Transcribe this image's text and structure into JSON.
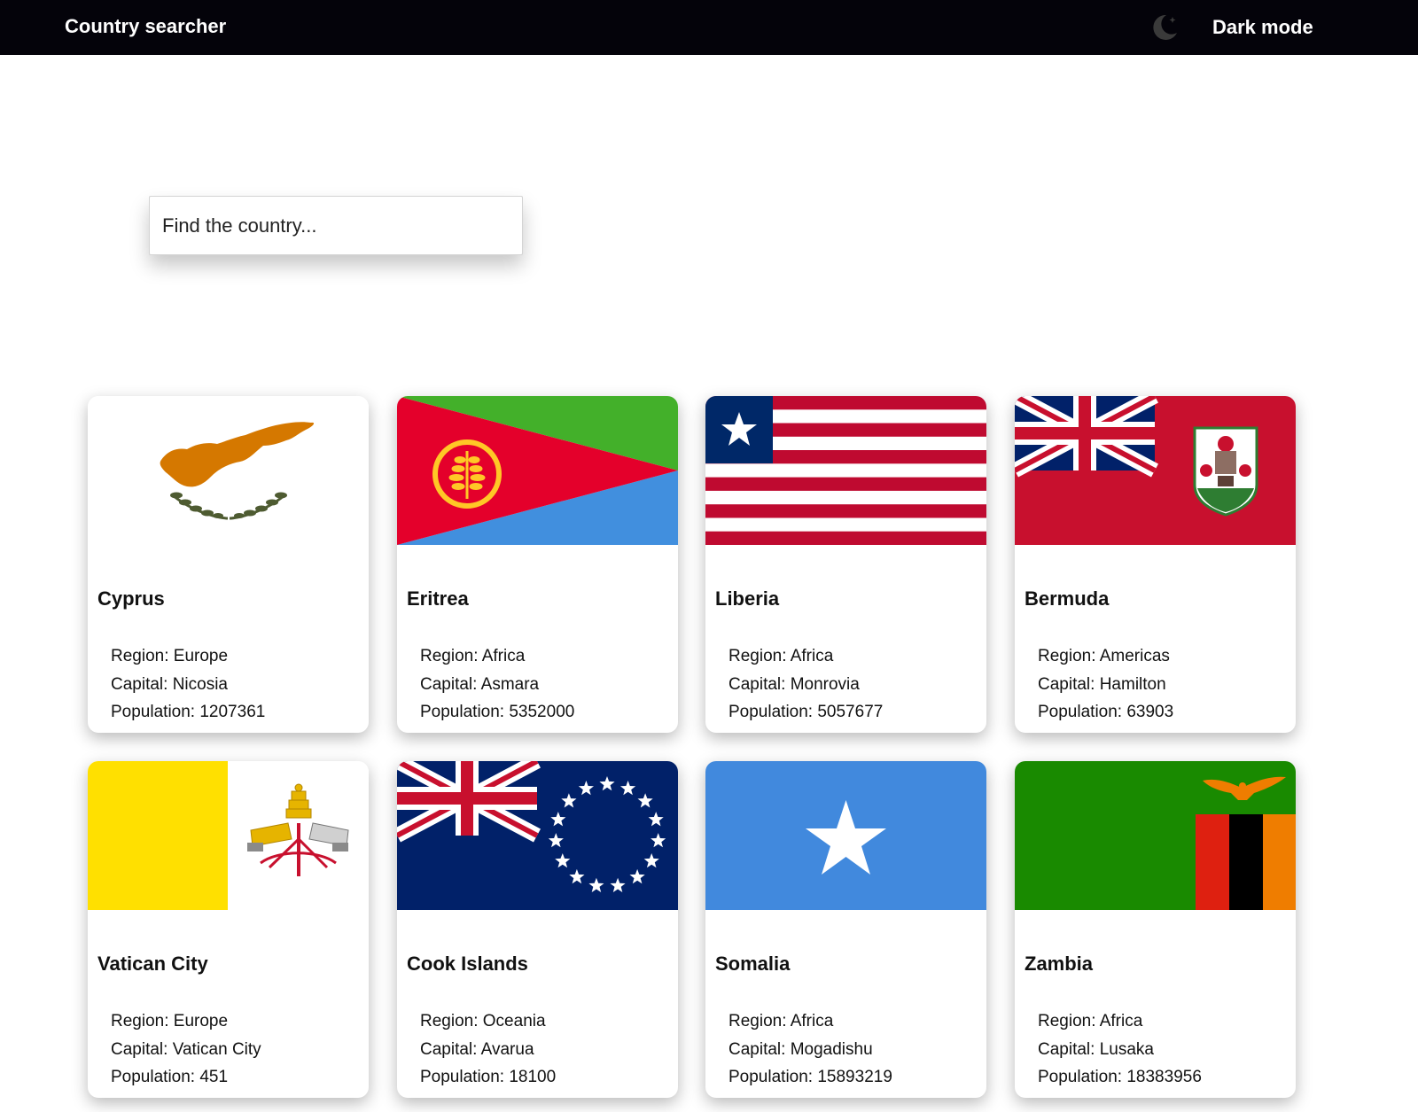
{
  "header": {
    "title": "Country searcher",
    "dark_mode_label": "Dark mode",
    "dark_mode_icon": "moon-icon",
    "background": "#04030a"
  },
  "search": {
    "placeholder": "Find the country...",
    "value": ""
  },
  "labels": {
    "region": "Region: ",
    "capital": "Capital: ",
    "population": "Population: "
  },
  "countries": [
    {
      "name": "Cyprus",
      "region": "Europe",
      "capital": "Nicosia",
      "population": "1207361",
      "flag_icon": "cyprus-flag-icon"
    },
    {
      "name": "Eritrea",
      "region": "Africa",
      "capital": "Asmara",
      "population": "5352000",
      "flag_icon": "eritrea-flag-icon"
    },
    {
      "name": "Liberia",
      "region": "Africa",
      "capital": "Monrovia",
      "population": "5057677",
      "flag_icon": "liberia-flag-icon"
    },
    {
      "name": "Bermuda",
      "region": "Americas",
      "capital": "Hamilton",
      "population": "63903",
      "flag_icon": "bermuda-flag-icon"
    },
    {
      "name": "Vatican City",
      "region": "Europe",
      "capital": "Vatican City",
      "population": "451",
      "flag_icon": "vatican-flag-icon"
    },
    {
      "name": "Cook Islands",
      "region": "Oceania",
      "capital": "Avarua",
      "population": "18100",
      "flag_icon": "cook-islands-flag-icon"
    },
    {
      "name": "Somalia",
      "region": "Africa",
      "capital": "Mogadishu",
      "population": "15893219",
      "flag_icon": "somalia-flag-icon"
    },
    {
      "name": "Zambia",
      "region": "Africa",
      "capital": "Lusaka",
      "population": "18383956",
      "flag_icon": "zambia-flag-icon"
    }
  ],
  "colors": {
    "header_bg": "#04030a",
    "card_bg": "#ffffff",
    "text": "#111111"
  }
}
